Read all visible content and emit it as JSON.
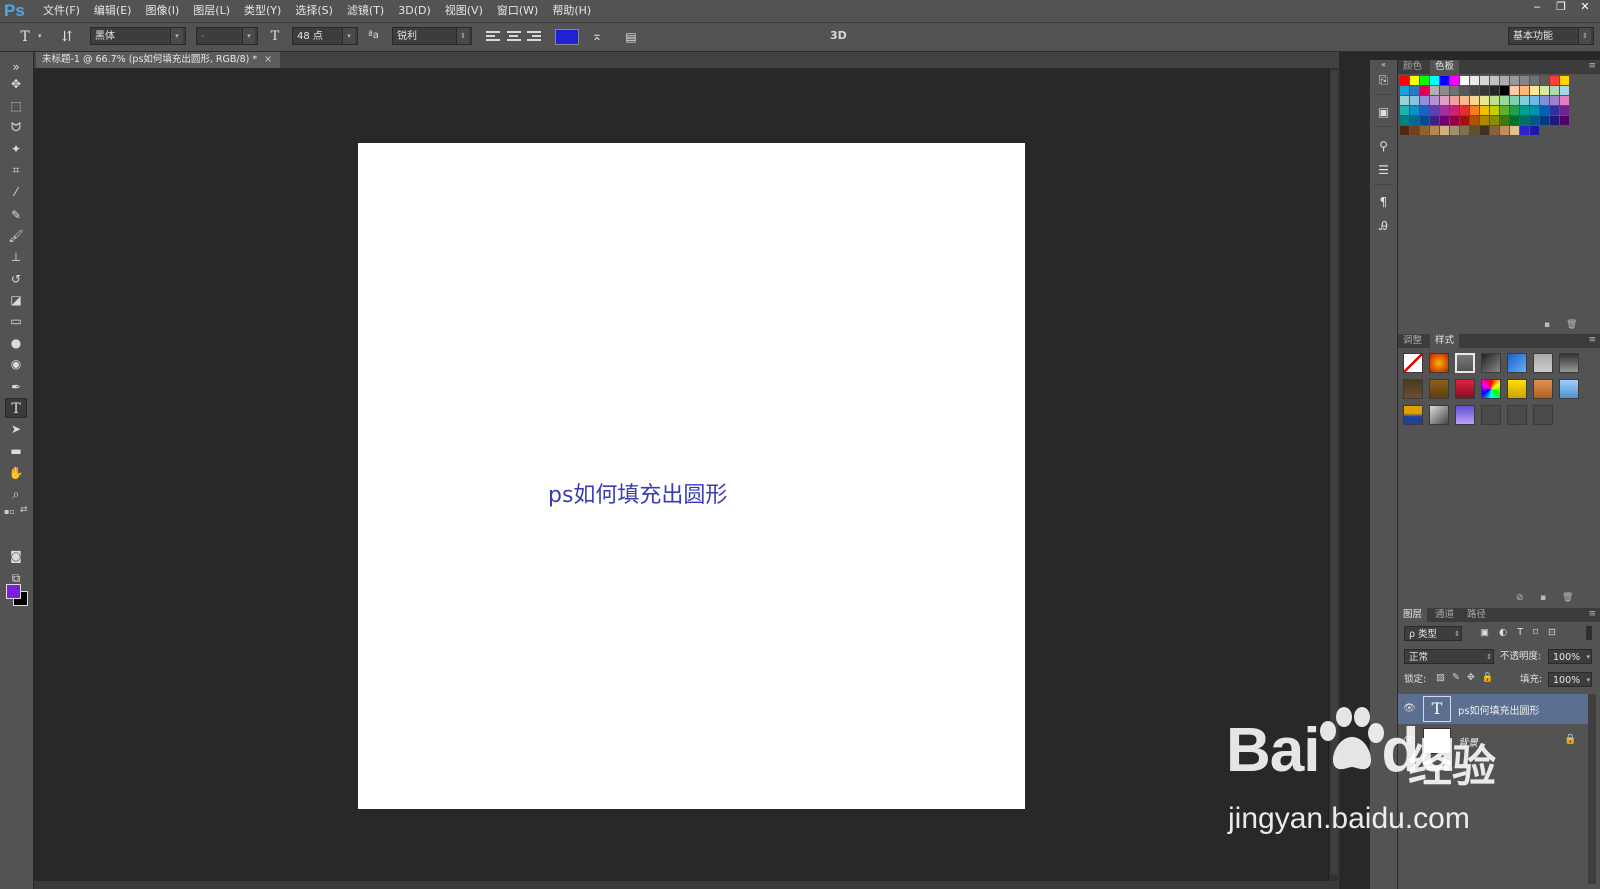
{
  "app": {
    "logo": "Ps",
    "menu": [
      "文件(F)",
      "编辑(E)",
      "图像(I)",
      "图层(L)",
      "类型(Y)",
      "选择(S)",
      "滤镜(T)",
      "3D(D)",
      "视图(V)",
      "窗口(W)",
      "帮助(H)"
    ],
    "window_controls": [
      "‒",
      "❐",
      "✕"
    ]
  },
  "options": {
    "font_family": "黑体",
    "font_style": "-",
    "font_size": "48 点",
    "antialias": "锐利",
    "text_color": "#1e22d2",
    "threed": "3D",
    "workspace": "基本功能"
  },
  "document": {
    "tab_title": "未标题-1 @ 66.7% (ps如何填充出圆形, RGB/8) *",
    "tab_close": "×",
    "canvas_text": "ps如何填充出圆形"
  },
  "tools": {
    "fg_color": "#7a1fe0",
    "bg_color": "#000000"
  },
  "panels": {
    "color_tabs": [
      "颜色",
      "色板"
    ],
    "adjust_tabs": [
      "调整",
      "样式"
    ],
    "layer_tabs": [
      "图层",
      "通道",
      "路径"
    ],
    "filter_kind": "ρ 类型",
    "blend_mode": "正常",
    "opacity_label": "不透明度:",
    "opacity_value": "100%",
    "lock_label": "锁定:",
    "fill_label": "填充:",
    "fill_value": "100%",
    "layers": [
      {
        "name": "ps如何填充出圆形",
        "thumb": "T"
      },
      {
        "name": "背景",
        "thumb": ""
      }
    ]
  },
  "watermark": {
    "logo": "Bai",
    "logo_tail": "du",
    "cn": "经验",
    "url": "jingyan.baidu.com"
  }
}
